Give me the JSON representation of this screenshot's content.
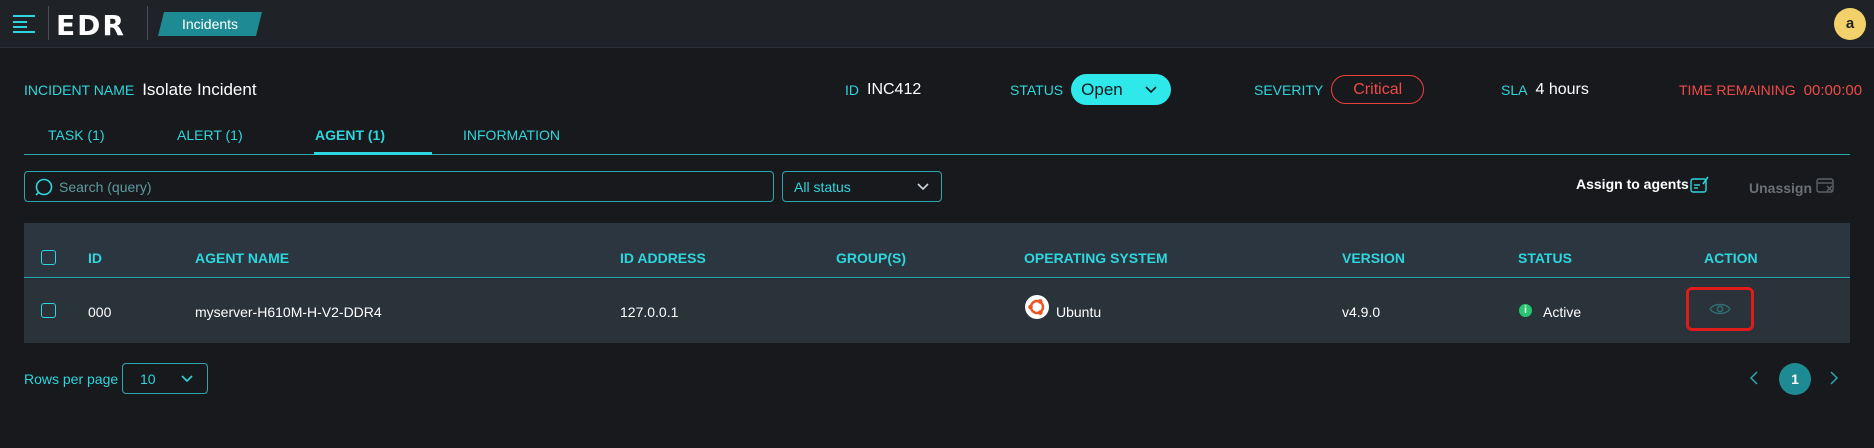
{
  "app": {
    "logo": "EDR",
    "breadcrumb": "Incidents",
    "avatar_initial": "a"
  },
  "incident": {
    "name_label": "INCIDENT NAME",
    "name": "Isolate Incident",
    "id_label": "ID",
    "id": "INC412",
    "status_label": "STATUS",
    "status": "Open",
    "severity_label": "SEVERITY",
    "severity": "Critical",
    "sla_label": "SLA",
    "sla": "4 hours",
    "time_remaining_label": "TIME REMAINING",
    "time_remaining": "00:00:00"
  },
  "tabs": [
    {
      "label": "TASK (1)",
      "active": false
    },
    {
      "label": "ALERT (1)",
      "active": false
    },
    {
      "label": "AGENT (1)",
      "active": true
    },
    {
      "label": "INFORMATION",
      "active": false
    }
  ],
  "toolbar": {
    "search_placeholder": "Search (query)",
    "status_filter": "All status",
    "assign_label": "Assign to agents",
    "unassign_label": "Unassign"
  },
  "table": {
    "columns": [
      "ID",
      "AGENT NAME",
      "ID ADDRESS",
      "GROUP(S)",
      "OPERATING SYSTEM",
      "VERSION",
      "STATUS",
      "ACTION"
    ],
    "rows": [
      {
        "id": "000",
        "agent_name": "myserver-H610M-H-V2-DDR4",
        "ip_address": "127.0.0.1",
        "groups": "",
        "os": "Ubuntu",
        "version": "v4.9.0",
        "status": "Active",
        "status_icon": "info-icon"
      }
    ]
  },
  "pagination": {
    "rows_per_page_label": "Rows per page",
    "rows_per_page": "10",
    "current_page": "1"
  },
  "colors": {
    "accent": "#2ed6dd",
    "critical": "#ee4b47",
    "active": "#28c76f",
    "highlight_box": "#e01b1b"
  }
}
